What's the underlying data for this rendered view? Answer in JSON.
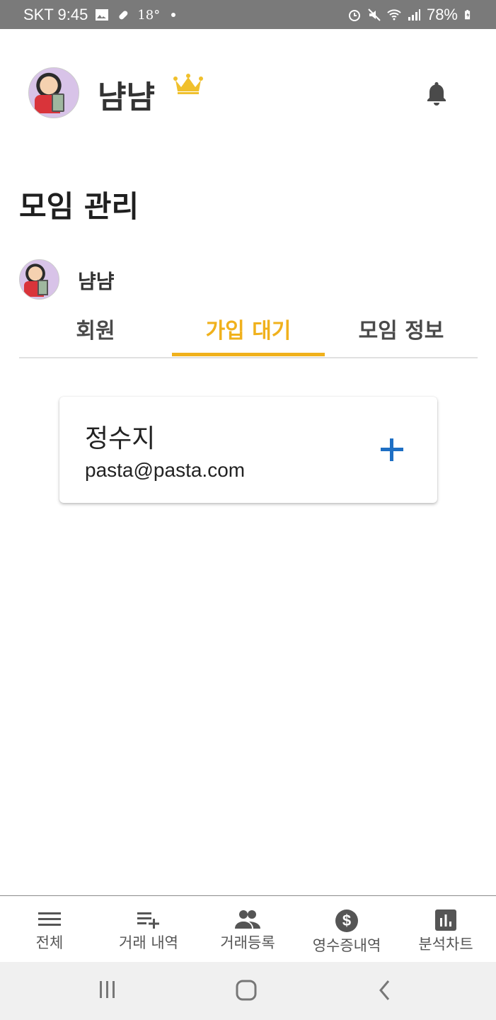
{
  "status_bar": {
    "carrier_time": "SKT 9:45",
    "temperature": "18°",
    "battery": "78%"
  },
  "header": {
    "username": "냠냠",
    "icons": [
      "crown-icon",
      "bell-icon"
    ]
  },
  "page": {
    "title": "모임 관리"
  },
  "group": {
    "name": "냠냠"
  },
  "tabs": [
    {
      "label": "회원"
    },
    {
      "label": "가입 대기",
      "active": true
    },
    {
      "label": "모임 정보"
    }
  ],
  "pending_requests": [
    {
      "name": "정수지",
      "email": "pasta@pasta.com"
    }
  ],
  "bottom_nav": [
    {
      "label": "전체",
      "icon": "menu-icon"
    },
    {
      "label": "거래 내역",
      "icon": "playlist-add-icon"
    },
    {
      "label": "거래등록",
      "icon": "people-icon"
    },
    {
      "label": "영수증내역",
      "icon": "dollar-circle-icon"
    },
    {
      "label": "분석차트",
      "icon": "bar-chart-icon"
    }
  ],
  "colors": {
    "accent": "#f0b11c",
    "add_button": "#1e6fc4",
    "status_bar": "#7a7a7a"
  }
}
